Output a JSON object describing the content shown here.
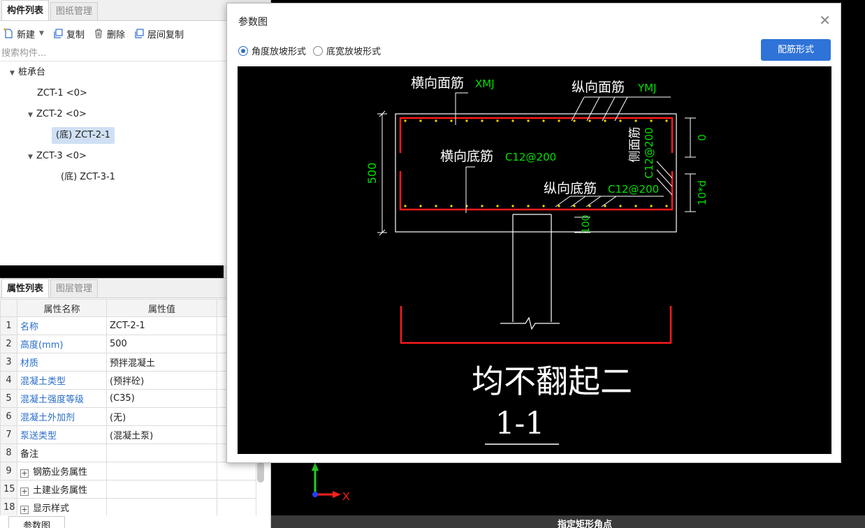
{
  "component_panel": {
    "tabs": [
      "构件列表",
      "图纸管理"
    ],
    "toolbar": {
      "new": "新建",
      "copy": "复制",
      "delete": "删除",
      "floor_copy": "层间复制"
    },
    "search_placeholder": "搜索构件...",
    "tree": {
      "root": "桩承台",
      "nodes": [
        "ZCT-1 <0>",
        "ZCT-2 <0>",
        "(底) ZCT-2-1",
        "ZCT-3 <0>",
        "(底) ZCT-3-1"
      ]
    }
  },
  "property_panel": {
    "tabs": [
      "属性列表",
      "图层管理"
    ],
    "headers": {
      "name": "属性名称",
      "value": "属性值"
    },
    "rows": [
      {
        "num": "1",
        "name": "名称",
        "value": "ZCT-2-1"
      },
      {
        "num": "2",
        "name": "高度(mm)",
        "value": "500"
      },
      {
        "num": "3",
        "name": "材质",
        "value": "预拌混凝土"
      },
      {
        "num": "4",
        "name": "混凝土类型",
        "value": "(预拌砼)"
      },
      {
        "num": "5",
        "name": "混凝土强度等级",
        "value": "(C35)"
      },
      {
        "num": "6",
        "name": "混凝土外加剂",
        "value": "(无)"
      },
      {
        "num": "7",
        "name": "泵送类型",
        "value": "(混凝土泵)"
      },
      {
        "num": "8",
        "name": "备注",
        "value": ""
      },
      {
        "num": "9",
        "name": "钢筋业务属性",
        "value": ""
      },
      {
        "num": "15",
        "name": "土建业务属性",
        "value": ""
      },
      {
        "num": "18",
        "name": "显示样式",
        "value": ""
      }
    ]
  },
  "bottom_tab": "参数图",
  "status": {
    "text": "指定矩形角点"
  },
  "axis_label": "X",
  "dialog": {
    "title": "参数图",
    "radio_angle": "角度放坡形式",
    "radio_width": "底宽放坡形式",
    "rebar_button": "配筋形式",
    "drawing": {
      "top_cross_label": "横向面筋",
      "top_cross_code": "XMJ",
      "top_long_label": "纵向面筋",
      "top_long_code": "YMJ",
      "bottom_cross_label": "横向底筋",
      "bottom_cross_code": "C12@200",
      "bottom_long_label": "纵向底筋",
      "bottom_long_code": "C12@200",
      "side_label": "侧面筋",
      "side_code": "C12@200",
      "height_value": "500",
      "dim_zero": "0",
      "dim_10d": "10*d",
      "dim_100": "100",
      "note": "均不翻起二",
      "section": "1-1"
    }
  },
  "colors": {
    "rebar": "#ff1a1a",
    "code_green": "#00e000",
    "accent": "#2f73d9",
    "prop_name": "#2a6ec9"
  }
}
